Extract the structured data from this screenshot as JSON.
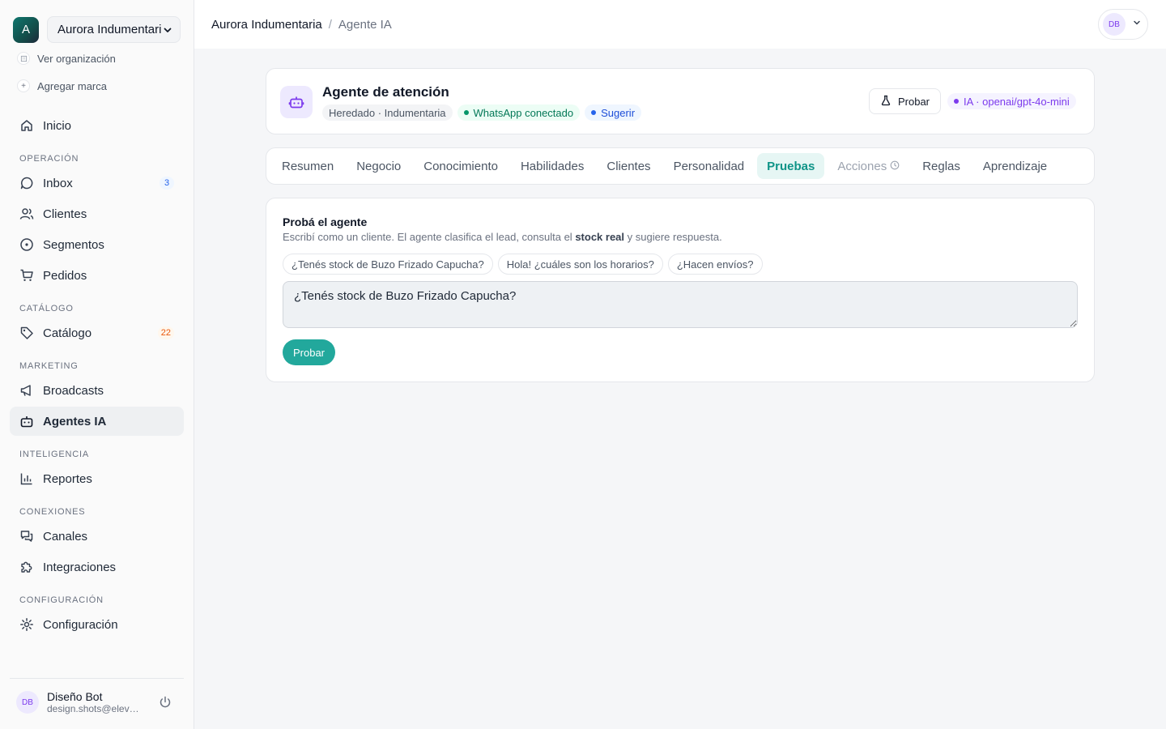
{
  "org": {
    "logo_letter": "A",
    "name": "Aurora Indumentaria",
    "view_org": "Ver organización",
    "add_brand": "Agregar marca"
  },
  "sidebar": {
    "home": "Inicio",
    "sections": {
      "operacion": "OPERACIÓN",
      "catalogo": "CATÁLOGO",
      "marketing": "MARKETING",
      "inteligencia": "INTELIGENCIA",
      "conexiones": "CONEXIONES",
      "configuracion": "CONFIGURACIÓN"
    },
    "items": {
      "inbox": "Inbox",
      "inbox_badge": "3",
      "clientes": "Clientes",
      "segmentos": "Segmentos",
      "pedidos": "Pedidos",
      "catalogo": "Catálogo",
      "catalogo_badge": "22",
      "broadcasts": "Broadcasts",
      "agentes": "Agentes IA",
      "reportes": "Reportes",
      "canales": "Canales",
      "integraciones": "Integraciones",
      "configuracion": "Configuración"
    },
    "user": {
      "initials": "DB",
      "name": "Diseño Bot",
      "email": "design.shots@eleven.ar"
    }
  },
  "header": {
    "breadcrumb_org": "Aurora Indumentaria",
    "breadcrumb_sep": "/",
    "breadcrumb_current": "Agente IA",
    "user_initials": "DB"
  },
  "agent": {
    "title": "Agente de atención",
    "tag_inherited": "Heredado · Indumentaria",
    "tag_whatsapp": "WhatsApp conectado",
    "tag_mode": "Sugerir",
    "test_button": "Probar",
    "model": "IA · openai/gpt-4o-mini"
  },
  "tabs": [
    "Resumen",
    "Negocio",
    "Conocimiento",
    "Habilidades",
    "Clientes",
    "Personalidad",
    "Pruebas",
    "Acciones",
    "Reglas",
    "Aprendizaje"
  ],
  "test": {
    "title": "Probá el agente",
    "desc_before": "Escribí como un cliente. El agente clasifica el lead, consulta el ",
    "desc_bold": "stock real",
    "desc_after": " y sugiere respuesta.",
    "chips": [
      "¿Tenés stock de Buzo Frizado Capucha?",
      "Hola! ¿cuáles son los horarios?",
      "¿Hacen envíos?"
    ],
    "input_value": "¿Tenés stock de Buzo Frizado Capucha?",
    "submit": "Probar"
  },
  "colors": {
    "accent": "#22a89c",
    "accent_bg": "#e6f6f4",
    "purple": "#7c3aed",
    "green": "#047857",
    "blue": "#1d4ed8"
  }
}
